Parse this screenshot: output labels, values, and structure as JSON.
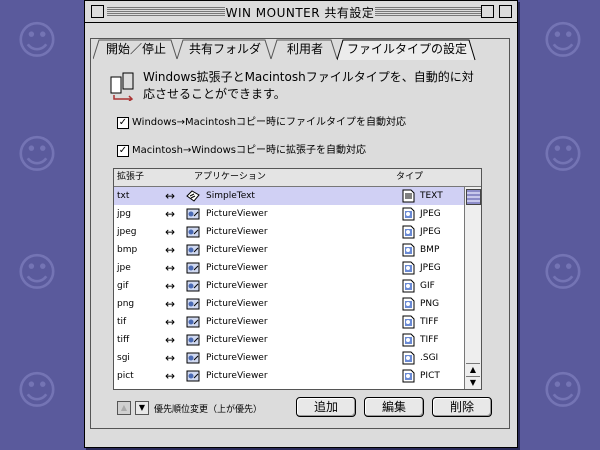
{
  "window": {
    "title": "WIN MOUNTER 共有設定"
  },
  "tabs": [
    {
      "label": "開始／停止"
    },
    {
      "label": "共有フォルダ"
    },
    {
      "label": "利用者"
    },
    {
      "label": "ファイルタイプの設定"
    }
  ],
  "intro": {
    "text": "Windows拡張子とMacintoshファイルタイプを、自動的に対応させることができます。"
  },
  "options": {
    "win_to_mac": {
      "label": "Windows→Macintoshコピー時にファイルタイプを自動対応",
      "checked": true,
      "mark": "✓"
    },
    "mac_to_win": {
      "label": "Macintosh→Windowsコピー時に拡張子を自動対応",
      "checked": true,
      "mark": "✓"
    }
  },
  "list": {
    "columns": {
      "ext": "拡張子",
      "app": "アプリケーション",
      "type": "タイプ"
    },
    "arrow": "↔",
    "rows": [
      {
        "ext": "txt",
        "app": "SimpleText",
        "type": "TEXT",
        "selected": true,
        "app_icon": "simpletext-icon"
      },
      {
        "ext": "jpg",
        "app": "PictureViewer",
        "type": "JPEG",
        "app_icon": "pictureviewer-icon"
      },
      {
        "ext": "jpeg",
        "app": "PictureViewer",
        "type": "JPEG",
        "app_icon": "pictureviewer-icon"
      },
      {
        "ext": "bmp",
        "app": "PictureViewer",
        "type": "BMP",
        "app_icon": "pictureviewer-icon"
      },
      {
        "ext": "jpe",
        "app": "PictureViewer",
        "type": "JPEG",
        "app_icon": "pictureviewer-icon"
      },
      {
        "ext": "gif",
        "app": "PictureViewer",
        "type": "GIF",
        "app_icon": "pictureviewer-icon"
      },
      {
        "ext": "png",
        "app": "PictureViewer",
        "type": "PNG",
        "app_icon": "pictureviewer-icon"
      },
      {
        "ext": "tif",
        "app": "PictureViewer",
        "type": "TIFF",
        "app_icon": "pictureviewer-icon"
      },
      {
        "ext": "tiff",
        "app": "PictureViewer",
        "type": "TIFF",
        "app_icon": "pictureviewer-icon"
      },
      {
        "ext": "sgi",
        "app": "PictureViewer",
        "type": ".SGI",
        "app_icon": "pictureviewer-icon"
      },
      {
        "ext": "pict",
        "app": "PictureViewer",
        "type": "PICT",
        "app_icon": "pictureviewer-icon"
      }
    ]
  },
  "priority": {
    "label": "優先順位変更（上が優先）",
    "up": "▲",
    "down": "▼"
  },
  "buttons": {
    "add": "追加",
    "edit": "編集",
    "delete": "削除"
  },
  "scroll": {
    "up": "▲",
    "down": "▼"
  },
  "colors": {
    "desktop": "#5a5a9c",
    "window": "#dcdcdc",
    "selection": "#d0d0f4"
  }
}
